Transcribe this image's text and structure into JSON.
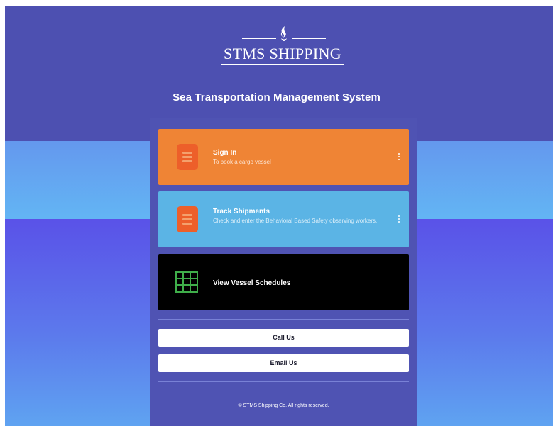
{
  "brand": {
    "name": "STMS SHIPPING",
    "system_title": "Sea Transportation Management System"
  },
  "cards": [
    {
      "title": "Sign In",
      "subtitle": "To book a cargo vessel",
      "icon": "list-icon",
      "color": "#ef8435"
    },
    {
      "title": "Track Shipments",
      "subtitle": "Check and enter the Behavioral Based Safety observing workers.",
      "icon": "list-icon",
      "color": "#5bb4e5"
    },
    {
      "title": "View Vessel Schedules",
      "subtitle": "",
      "icon": "table-grid-icon",
      "color": "#000000"
    }
  ],
  "actions": {
    "call_label": "Call Us",
    "email_label": "Email Us"
  },
  "footer": {
    "copyright": "© STMS Shipping Co. All rights reserved."
  },
  "colors": {
    "header_bg": "#4d50b1",
    "panel_bg": "#4f53b3",
    "accent_orange": "#ef8435",
    "accent_blue": "#5bb4e5",
    "icon_orange": "#ed5f2a",
    "grid_green": "#3fae4a"
  }
}
